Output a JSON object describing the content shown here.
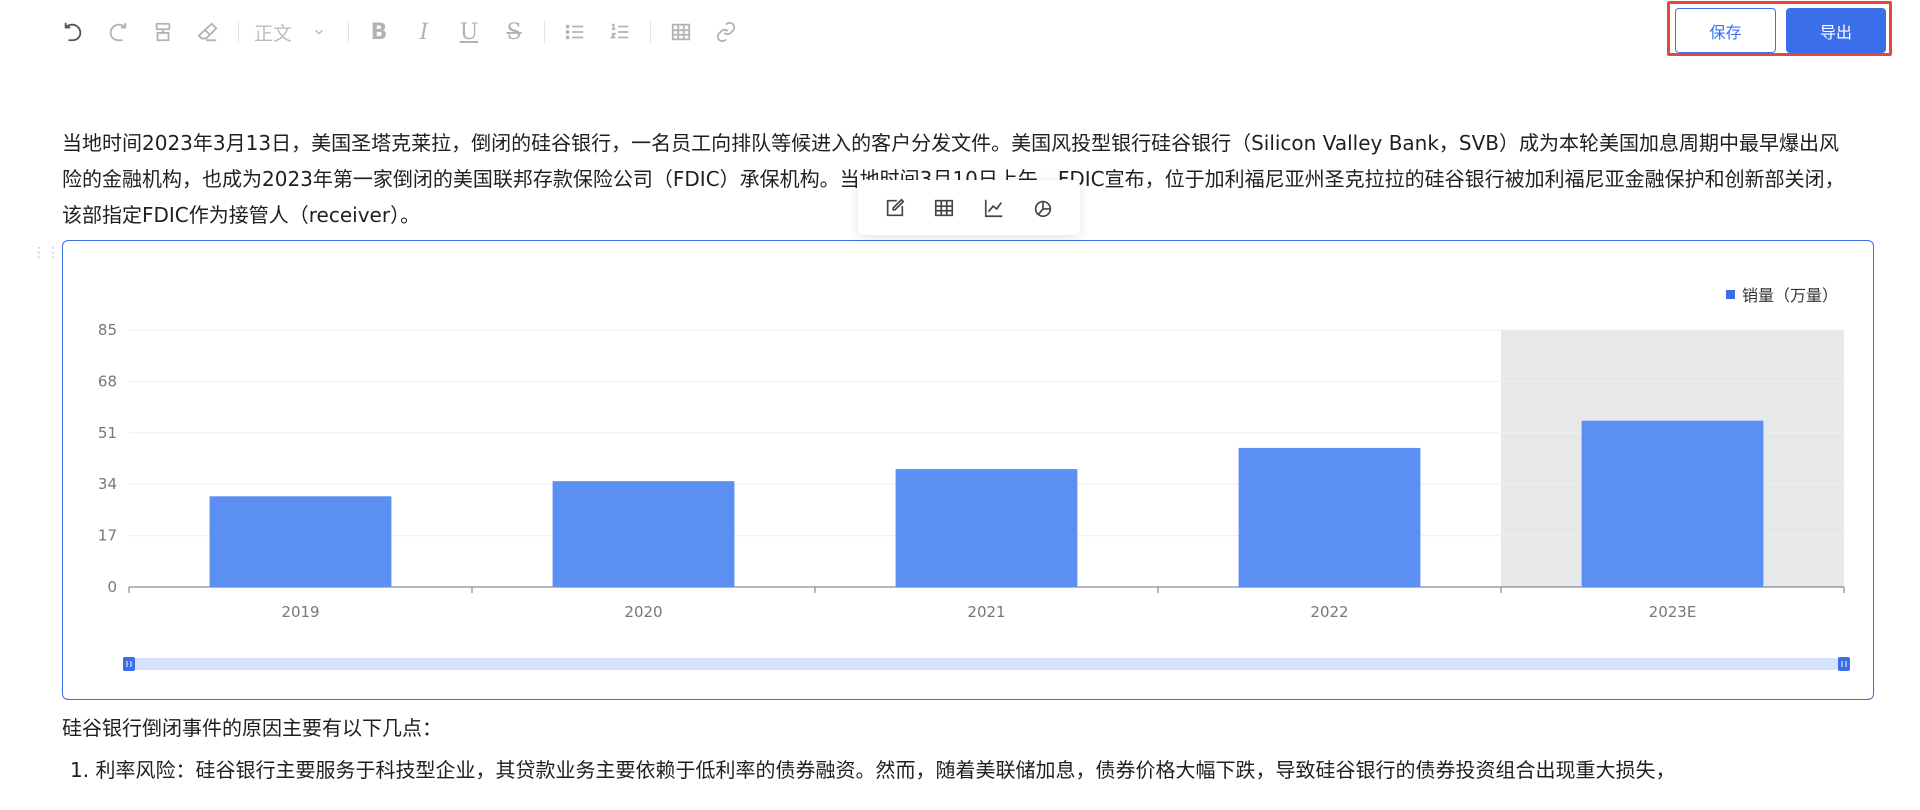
{
  "toolbar": {
    "block_style": "正文",
    "icons": [
      "undo-icon",
      "redo-icon",
      "format-painter-icon",
      "eraser-icon",
      "bold-icon",
      "italic-icon",
      "underline-icon",
      "strikethrough-icon",
      "bullet-list-icon",
      "numbered-list-icon",
      "table-icon",
      "link-icon"
    ],
    "bold": "B",
    "italic": "I",
    "underline": "U",
    "strike": "S"
  },
  "actions": {
    "save_label": "保存",
    "export_label": "导出"
  },
  "paragraphs": {
    "intro": "当地时间2023年3月13日，美国圣塔克莱拉，倒闭的硅谷银行，一名员工向排队等候进入的客户分发文件。美国风投型银行硅谷银行（Silicon Valley Bank，SVB）成为本轮美国加息周期中最早爆出风险的金融机构，也成为2023年第一家倒闭的美国联邦存款保险公司（FDIC）承保机构。当地时间3月10日上午，FDIC宣布，位于加利福尼亚州圣克拉拉的硅谷银行被加利福尼亚金融保护和创新部关闭，该部指定FDIC作为接管人（receiver）。",
    "reasons_heading": "硅谷银行倒闭事件的原因主要有以下几点：",
    "reason_1": "1. 利率风险：硅谷银行主要服务于科技型企业，其贷款业务主要依赖于低利率的债券融资。然而，随着美联储加息，债券价格大幅下跌，导致硅谷银行的债券投资组合出现重大损失，"
  },
  "chart_toolbar": {
    "icons": [
      "edit-icon",
      "table-icon",
      "line-chart-icon",
      "pie-chart-icon"
    ]
  },
  "chart_data": {
    "type": "bar",
    "categories": [
      "2019",
      "2020",
      "2021",
      "2022",
      "2023E"
    ],
    "series": [
      {
        "name": "销量（万量）",
        "values": [
          30,
          35,
          39,
          46,
          55
        ]
      }
    ],
    "yticks": [
      0,
      17,
      34,
      51,
      68,
      85
    ],
    "ylim": [
      0,
      85
    ],
    "highlighted_category": "2023E",
    "grid": true,
    "legend": "top-right",
    "colors": {
      "bar": "#5b8ff2",
      "highlight_bg": "#e7e8ea",
      "legend_marker": "#3b6ee9",
      "slider_track": "#d6e2fb",
      "slider_handle": "#3b6ee9"
    },
    "data_zoom_range": [
      0,
      100
    ]
  }
}
